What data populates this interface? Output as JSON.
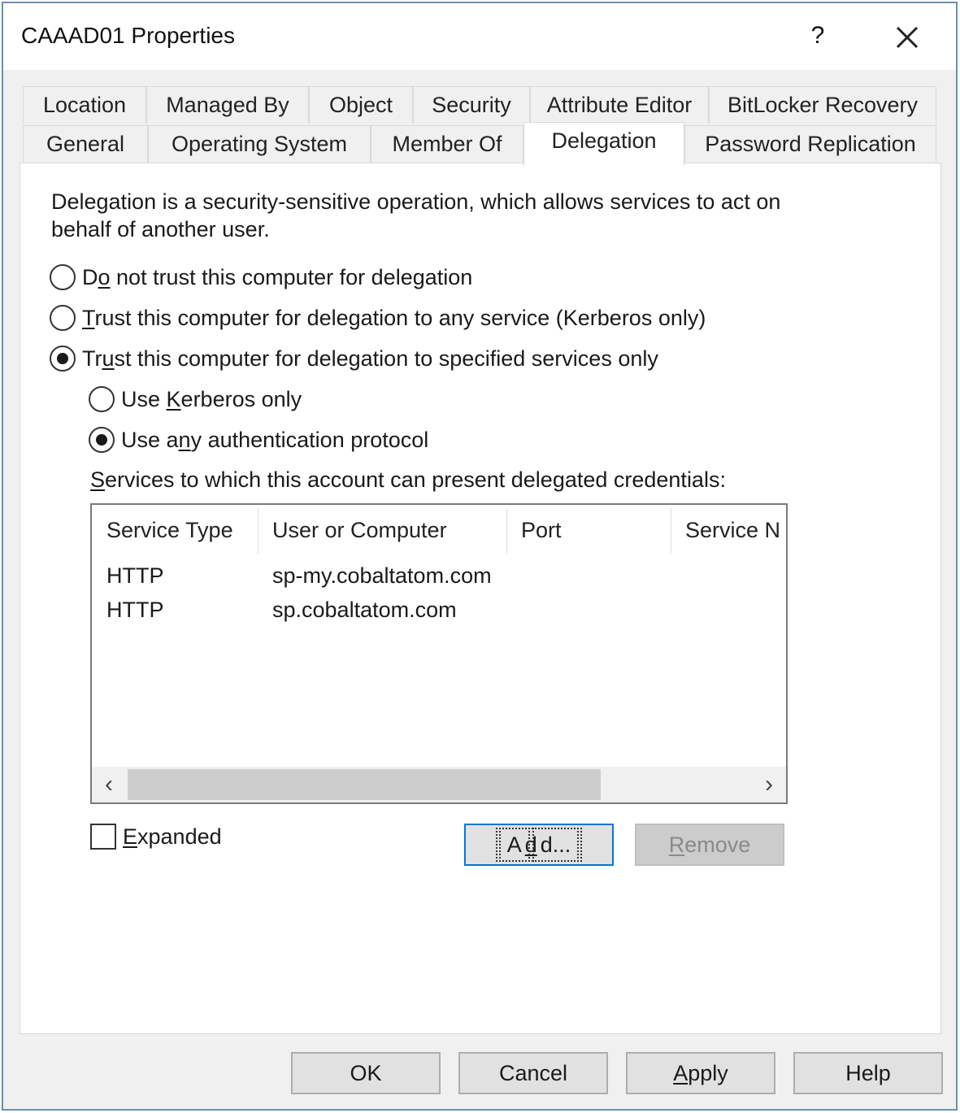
{
  "window": {
    "title": "CAAAD01 Properties",
    "help_label": "?"
  },
  "tabs": {
    "row1": [
      "Location",
      "Managed By",
      "Object",
      "Security",
      "Attribute Editor",
      "BitLocker Recovery"
    ],
    "row2": [
      "General",
      "Operating System",
      "Member Of",
      "Delegation",
      "Password Replication"
    ],
    "active": "Delegation"
  },
  "delegation": {
    "intro": "Delegation is a security-sensitive operation, which allows services to act on behalf of another user.",
    "options": [
      {
        "pre": "D",
        "mn": "o",
        "post": " not trust this computer for delegation",
        "checked": false
      },
      {
        "pre": "",
        "mn": "T",
        "post": "rust this computer for delegation to any service (Kerberos only)",
        "checked": false
      },
      {
        "pre": "Tr",
        "mn": "u",
        "post": "st this computer for delegation to specified services only",
        "checked": true
      }
    ],
    "sub_options": [
      {
        "pre": "Use ",
        "mn": "K",
        "post": "erberos only",
        "checked": false
      },
      {
        "pre": "Use a",
        "mn": "n",
        "post": "y authentication protocol",
        "checked": true
      }
    ],
    "services_label": {
      "pre": "",
      "mn": "S",
      "post": "ervices to which this account can present delegated credentials:"
    },
    "columns": [
      "Service Type",
      "User or Computer",
      "Port",
      "Service N"
    ],
    "rows": [
      {
        "service_type": "HTTP",
        "user_or_computer": "sp-my.cobaltatom.com",
        "port": "",
        "service_name": ""
      },
      {
        "service_type": "HTTP",
        "user_or_computer": "sp.cobaltatom.com",
        "port": "",
        "service_name": ""
      }
    ],
    "expanded": {
      "pre": "",
      "mn": "E",
      "post": "xpanded",
      "checked": false
    },
    "add_button": {
      "pre": "A",
      "mn": "d",
      "post": "d..."
    },
    "remove_button": {
      "pre": "",
      "mn": "R",
      "post": "emove"
    }
  },
  "footer": {
    "ok": "OK",
    "cancel": "Cancel",
    "apply": {
      "pre": "",
      "mn": "A",
      "post": "pply"
    },
    "help": "Help"
  }
}
